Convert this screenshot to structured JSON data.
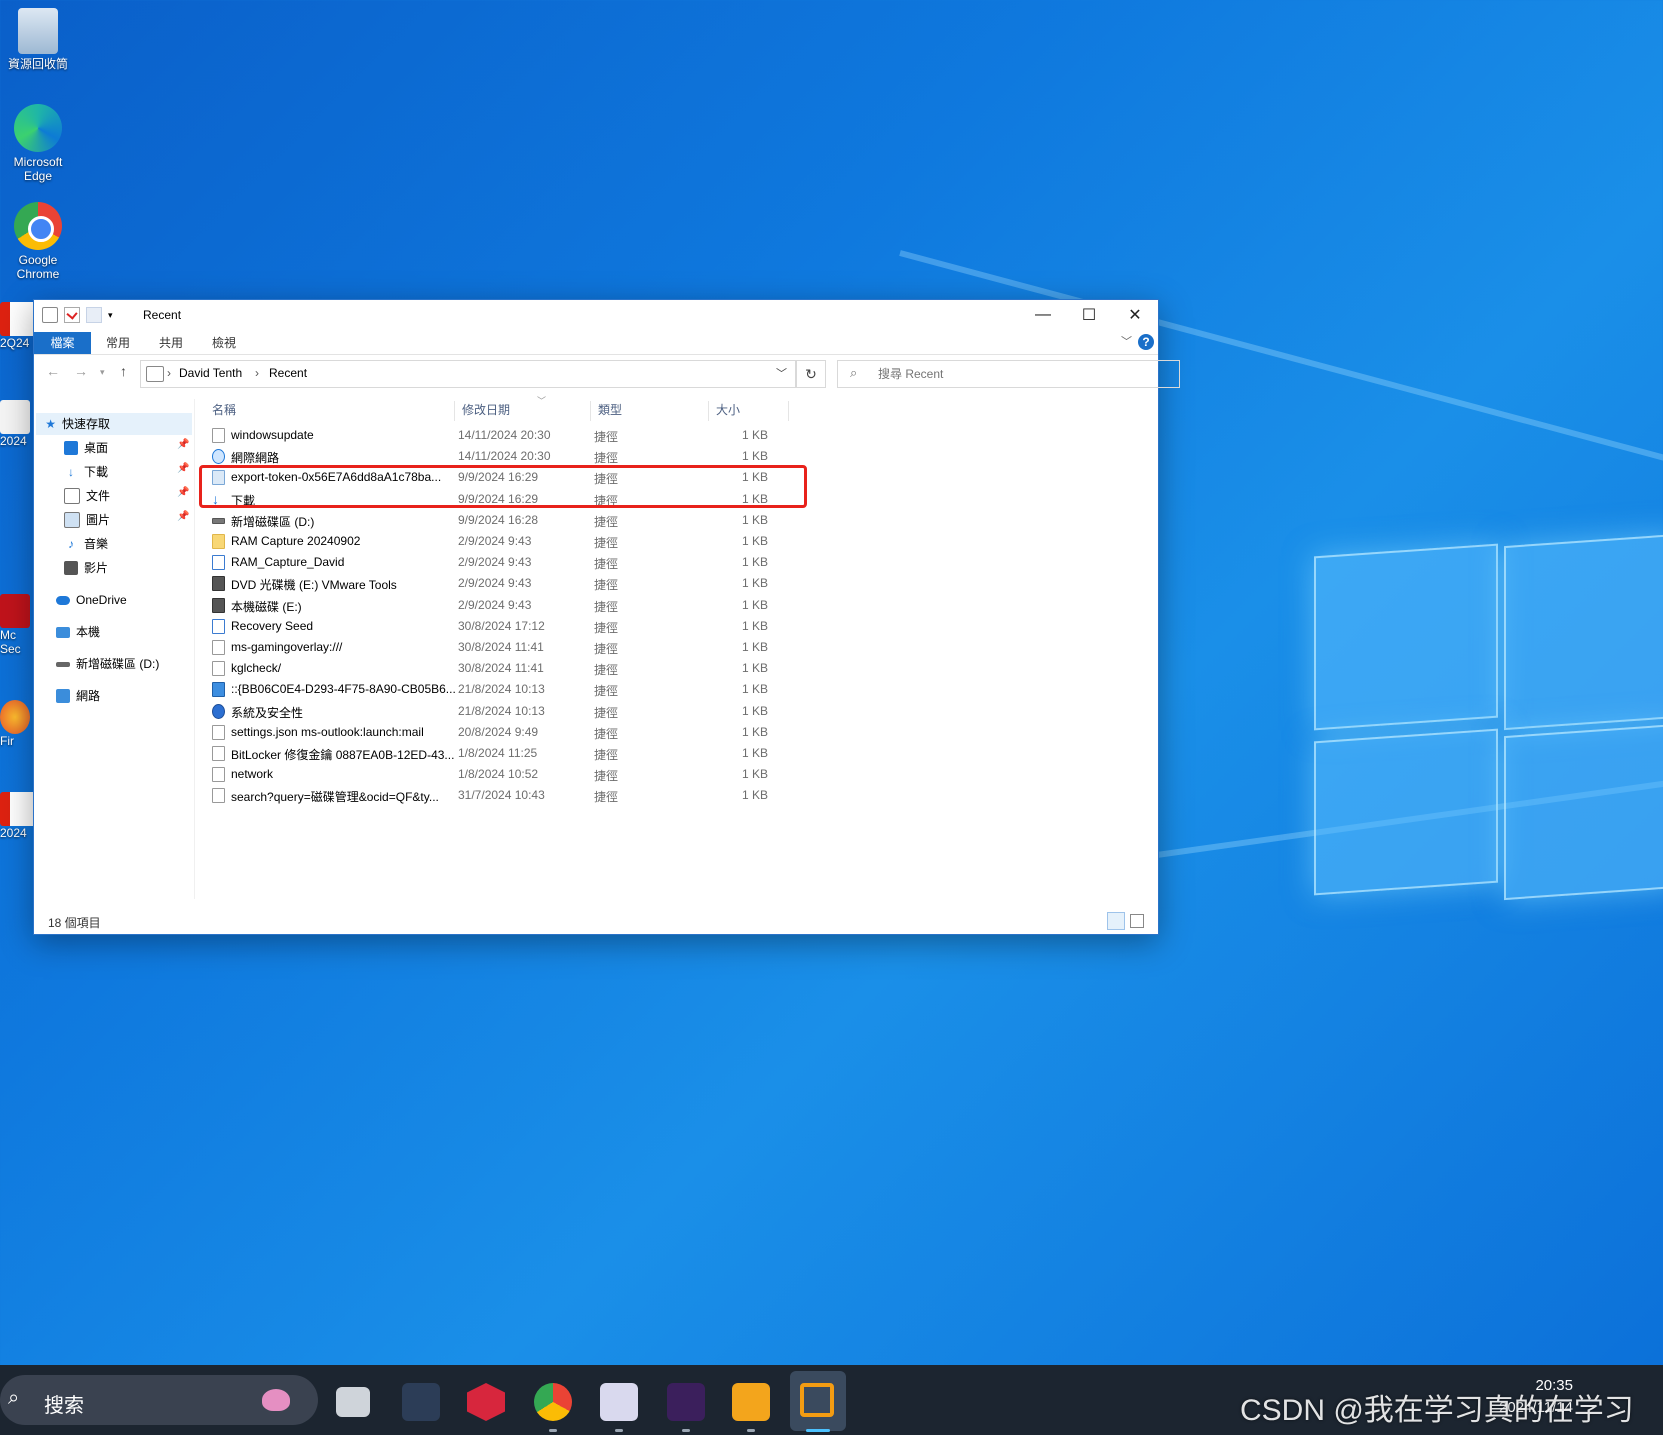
{
  "desktop": {
    "icons": [
      {
        "label": "資源回收筒",
        "icon": "recycle-bin-icon"
      },
      {
        "label": "Microsoft Edge",
        "icon": "edge-icon"
      },
      {
        "label": "Google Chrome",
        "icon": "chrome-icon"
      }
    ],
    "partial_icons": [
      {
        "label": "2Q24",
        "icon": "pdf-icon"
      },
      {
        "label": "2024",
        "icon": "file-icon"
      },
      {
        "label": "Mc Sec",
        "icon": "mcafee-icon"
      },
      {
        "label": "Fir",
        "icon": "firefox-icon"
      },
      {
        "label": "2024",
        "icon": "pdf-icon"
      }
    ]
  },
  "window": {
    "title": "Recent",
    "controls": {
      "minimize": "—",
      "maximize": "☐",
      "close": "✕"
    },
    "ribbon_tabs": [
      "檔案",
      "常用",
      "共用",
      "檢視"
    ],
    "help": "?",
    "address": {
      "crumbs": [
        "David Tenth",
        "Recent"
      ],
      "separator": "›"
    },
    "search_placeholder": "搜尋 Recent",
    "nav_pane": {
      "quick_access": "快速存取",
      "pinned": [
        {
          "label": "桌面",
          "icon": "desktop-folder-icon"
        },
        {
          "label": "下載",
          "icon": "download-folder-icon"
        },
        {
          "label": "文件",
          "icon": "documents-folder-icon"
        },
        {
          "label": "圖片",
          "icon": "pictures-folder-icon"
        },
        {
          "label": "音樂",
          "icon": "music-folder-icon"
        },
        {
          "label": "影片",
          "icon": "videos-folder-icon"
        }
      ],
      "onedrive": "OneDrive",
      "this_pc": "本機",
      "drive_d": "新增磁碟區 (D:)",
      "network": "網路"
    },
    "columns": {
      "name": "名稱",
      "date": "修改日期",
      "type": "類型",
      "size": "大小"
    },
    "files": [
      {
        "name": "windowsupdate",
        "date": "14/11/2024 20:30",
        "type": "捷徑",
        "size": "1 KB",
        "icon": "file-icon"
      },
      {
        "name": "網際網路",
        "date": "14/11/2024 20:30",
        "type": "捷徑",
        "size": "1 KB",
        "icon": "ie-icon"
      },
      {
        "name": "export-token-0x56E7A6dd8aA1c78ba...",
        "date": "9/9/2024 16:29",
        "type": "捷徑",
        "size": "1 KB",
        "icon": "text-file-icon"
      },
      {
        "name": "下載",
        "date": "9/9/2024 16:29",
        "type": "捷徑",
        "size": "1 KB",
        "icon": "download-arrow-icon"
      },
      {
        "name": "新增磁碟區 (D:)",
        "date": "9/9/2024 16:28",
        "type": "捷徑",
        "size": "1 KB",
        "icon": "drive-icon"
      },
      {
        "name": "RAM Capture 20240902",
        "date": "2/9/2024 9:43",
        "type": "捷徑",
        "size": "1 KB",
        "icon": "folder-icon"
      },
      {
        "name": "RAM_Capture_David",
        "date": "2/9/2024 9:43",
        "type": "捷徑",
        "size": "1 KB",
        "icon": "document-icon"
      },
      {
        "name": "DVD 光碟機 (E:) VMware Tools",
        "date": "2/9/2024 9:43",
        "type": "捷徑",
        "size": "1 KB",
        "icon": "vmware-icon"
      },
      {
        "name": "本機磁碟 (E:)",
        "date": "2/9/2024 9:43",
        "type": "捷徑",
        "size": "1 KB",
        "icon": "vmware-icon"
      },
      {
        "name": "Recovery Seed",
        "date": "30/8/2024 17:12",
        "type": "捷徑",
        "size": "1 KB",
        "icon": "document-icon"
      },
      {
        "name": "ms-gamingoverlay:///",
        "date": "30/8/2024 11:41",
        "type": "捷徑",
        "size": "1 KB",
        "icon": "file-icon"
      },
      {
        "name": "kglcheck/",
        "date": "30/8/2024 11:41",
        "type": "捷徑",
        "size": "1 KB",
        "icon": "file-icon"
      },
      {
        "name": "::{BB06C0E4-D293-4F75-8A90-CB05B6...",
        "date": "21/8/2024 10:13",
        "type": "捷徑",
        "size": "1 KB",
        "icon": "control-panel-icon"
      },
      {
        "name": "系統及安全性",
        "date": "21/8/2024 10:13",
        "type": "捷徑",
        "size": "1 KB",
        "icon": "shield-icon"
      },
      {
        "name": "settings.json ms-outlook:launch:mail",
        "date": "20/8/2024 9:49",
        "type": "捷徑",
        "size": "1 KB",
        "icon": "file-icon"
      },
      {
        "name": "BitLocker 修復金鑰 0887EA0B-12ED-43...",
        "date": "1/8/2024 11:25",
        "type": "捷徑",
        "size": "1 KB",
        "icon": "file-icon"
      },
      {
        "name": "network",
        "date": "1/8/2024 10:52",
        "type": "捷徑",
        "size": "1 KB",
        "icon": "file-icon"
      },
      {
        "name": "search?query=磁碟管理&ocid=QF&ty...",
        "date": "31/7/2024 10:43",
        "type": "捷徑",
        "size": "1 KB",
        "icon": "file-icon"
      }
    ],
    "highlight_color": "#e8221b",
    "status": "18 個項目"
  },
  "taskbar": {
    "search_label": "搜索",
    "apps": [
      "task-view-icon",
      "cat-app-icon",
      "hexagon-app-icon",
      "chrome-icon",
      "magnifier-app-icon",
      "pen-app-icon",
      "orange-pen-app-icon",
      "vmware-app-icon"
    ],
    "clock_time": "20:35",
    "clock_date": "2024/11/14",
    "watermark": "CSDN @我在学习真的在学习"
  }
}
